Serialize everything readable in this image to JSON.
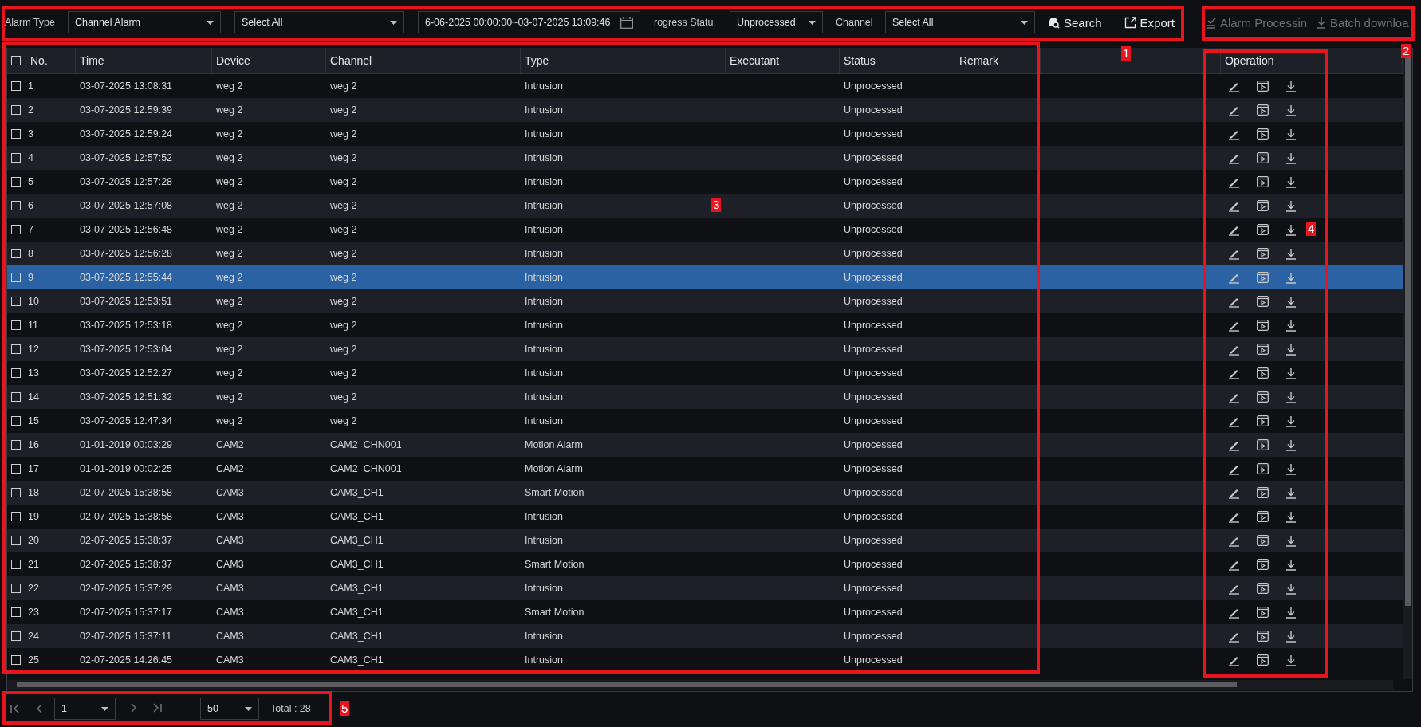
{
  "toolbar": {
    "filters": [
      {
        "kind": "label",
        "text": "Alarm Type"
      },
      {
        "kind": "select",
        "value": "Channel Alarm"
      },
      {
        "kind": "select",
        "value": "Select All"
      },
      {
        "kind": "date",
        "value": "6-06-2025 00:00:00~03-07-2025 13:09:46"
      },
      {
        "kind": "label",
        "text": "rogress Statu"
      },
      {
        "kind": "select",
        "value": "Unprocessed"
      },
      {
        "kind": "label",
        "text": "Channel"
      },
      {
        "kind": "select",
        "value": "Select All"
      }
    ],
    "actions": [
      {
        "kind": "search",
        "label": "Search",
        "disabled": false
      },
      {
        "kind": "export",
        "label": "Export",
        "disabled": false
      },
      {
        "kind": "process",
        "label": "Alarm Processin",
        "disabled": true
      },
      {
        "kind": "download",
        "label": "Batch downloa",
        "disabled": true
      }
    ]
  },
  "table": {
    "header_checked": false,
    "columns": [
      "No.",
      "Time",
      "Device",
      "Channel",
      "Type",
      "Executant",
      "Status",
      "Remark",
      "Operation"
    ],
    "rows": [
      {
        "no": "1",
        "time": "03-07-2025 13:08:31",
        "device": "weg 2",
        "channel": "weg 2",
        "type": "Intrusion",
        "status": "Unprocessed",
        "checked": false,
        "selected": false
      },
      {
        "no": "2",
        "time": "03-07-2025 12:59:39",
        "device": "weg 2",
        "channel": "weg 2",
        "type": "Intrusion",
        "status": "Unprocessed",
        "checked": false,
        "selected": false
      },
      {
        "no": "3",
        "time": "03-07-2025 12:59:24",
        "device": "weg 2",
        "channel": "weg 2",
        "type": "Intrusion",
        "status": "Unprocessed",
        "checked": false,
        "selected": false
      },
      {
        "no": "4",
        "time": "03-07-2025 12:57:52",
        "device": "weg 2",
        "channel": "weg 2",
        "type": "Intrusion",
        "status": "Unprocessed",
        "checked": false,
        "selected": false
      },
      {
        "no": "5",
        "time": "03-07-2025 12:57:28",
        "device": "weg 2",
        "channel": "weg 2",
        "type": "Intrusion",
        "status": "Unprocessed",
        "checked": false,
        "selected": false
      },
      {
        "no": "6",
        "time": "03-07-2025 12:57:08",
        "device": "weg 2",
        "channel": "weg 2",
        "type": "Intrusion",
        "status": "Unprocessed",
        "checked": false,
        "selected": false
      },
      {
        "no": "7",
        "time": "03-07-2025 12:56:48",
        "device": "weg 2",
        "channel": "weg 2",
        "type": "Intrusion",
        "status": "Unprocessed",
        "checked": false,
        "selected": false
      },
      {
        "no": "8",
        "time": "03-07-2025 12:56:28",
        "device": "weg 2",
        "channel": "weg 2",
        "type": "Intrusion",
        "status": "Unprocessed",
        "checked": false,
        "selected": false
      },
      {
        "no": "9",
        "time": "03-07-2025 12:55:44",
        "device": "weg 2",
        "channel": "weg 2",
        "type": "Intrusion",
        "status": "Unprocessed",
        "checked": false,
        "selected": true
      },
      {
        "no": "10",
        "time": "03-07-2025 12:53:51",
        "device": "weg 2",
        "channel": "weg 2",
        "type": "Intrusion",
        "status": "Unprocessed",
        "checked": false,
        "selected": false
      },
      {
        "no": "11",
        "time": "03-07-2025 12:53:18",
        "device": "weg 2",
        "channel": "weg 2",
        "type": "Intrusion",
        "status": "Unprocessed",
        "checked": false,
        "selected": false
      },
      {
        "no": "12",
        "time": "03-07-2025 12:53:04",
        "device": "weg 2",
        "channel": "weg 2",
        "type": "Intrusion",
        "status": "Unprocessed",
        "checked": false,
        "selected": false
      },
      {
        "no": "13",
        "time": "03-07-2025 12:52:27",
        "device": "weg 2",
        "channel": "weg 2",
        "type": "Intrusion",
        "status": "Unprocessed",
        "checked": false,
        "selected": false
      },
      {
        "no": "14",
        "time": "03-07-2025 12:51:32",
        "device": "weg 2",
        "channel": "weg 2",
        "type": "Intrusion",
        "status": "Unprocessed",
        "checked": false,
        "selected": false
      },
      {
        "no": "15",
        "time": "03-07-2025 12:47:34",
        "device": "weg 2",
        "channel": "weg 2",
        "type": "Intrusion",
        "status": "Unprocessed",
        "checked": false,
        "selected": false
      },
      {
        "no": "16",
        "time": "01-01-2019 00:03:29",
        "device": "CAM2",
        "channel": "CAM2_CHN001",
        "type": "Motion Alarm",
        "status": "Unprocessed",
        "checked": false,
        "selected": false
      },
      {
        "no": "17",
        "time": "01-01-2019 00:02:25",
        "device": "CAM2",
        "channel": "CAM2_CHN001",
        "type": "Motion Alarm",
        "status": "Unprocessed",
        "checked": false,
        "selected": false
      },
      {
        "no": "18",
        "time": "02-07-2025 15:38:58",
        "device": "CAM3",
        "channel": "CAM3_CH1",
        "type": "Smart Motion",
        "status": "Unprocessed",
        "checked": false,
        "selected": false
      },
      {
        "no": "19",
        "time": "02-07-2025 15:38:58",
        "device": "CAM3",
        "channel": "CAM3_CH1",
        "type": "Intrusion",
        "status": "Unprocessed",
        "checked": false,
        "selected": false
      },
      {
        "no": "20",
        "time": "02-07-2025 15:38:37",
        "device": "CAM3",
        "channel": "CAM3_CH1",
        "type": "Intrusion",
        "status": "Unprocessed",
        "checked": false,
        "selected": false
      },
      {
        "no": "21",
        "time": "02-07-2025 15:38:37",
        "device": "CAM3",
        "channel": "CAM3_CH1",
        "type": "Smart Motion",
        "status": "Unprocessed",
        "checked": false,
        "selected": false
      },
      {
        "no": "22",
        "time": "02-07-2025 15:37:29",
        "device": "CAM3",
        "channel": "CAM3_CH1",
        "type": "Intrusion",
        "status": "Unprocessed",
        "checked": false,
        "selected": false
      },
      {
        "no": "23",
        "time": "02-07-2025 15:37:17",
        "device": "CAM3",
        "channel": "CAM3_CH1",
        "type": "Smart Motion",
        "status": "Unprocessed",
        "checked": false,
        "selected": false
      },
      {
        "no": "24",
        "time": "02-07-2025 15:37:11",
        "device": "CAM3",
        "channel": "CAM3_CH1",
        "type": "Intrusion",
        "status": "Unprocessed",
        "checked": false,
        "selected": false
      },
      {
        "no": "25",
        "time": "02-07-2025 14:26:45",
        "device": "CAM3",
        "channel": "CAM3_CH1",
        "type": "Intrusion",
        "status": "Unprocessed",
        "checked": false,
        "selected": false
      }
    ]
  },
  "pagination": {
    "page": "1",
    "per_page": "50",
    "total": "Total : 28"
  },
  "annotations": [
    {
      "label": "1"
    },
    {
      "label": "2"
    },
    {
      "label": "3"
    },
    {
      "label": "4"
    },
    {
      "label": "5"
    }
  ]
}
